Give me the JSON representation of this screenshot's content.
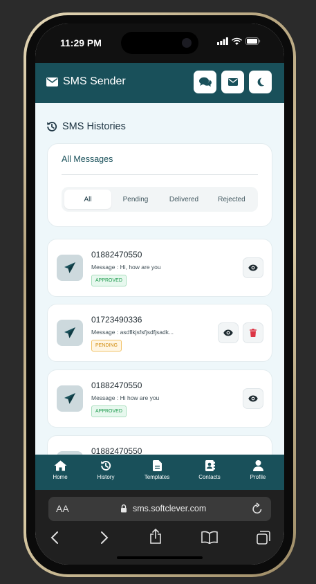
{
  "status_bar": {
    "time": "11:29 PM"
  },
  "header": {
    "title": "SMS Sender",
    "buttons": [
      "chat-icon",
      "envelope-icon",
      "moon-icon"
    ]
  },
  "section": {
    "title": "SMS Histories"
  },
  "filter": {
    "title": "All Messages",
    "tabs": [
      "All",
      "Pending",
      "Delivered",
      "Rejected"
    ],
    "active_tab": "All"
  },
  "messages": [
    {
      "number": "01882470550",
      "text": "Message : Hi, how are you",
      "status": "APPROVED"
    },
    {
      "number": "01723490336",
      "text": "Message : asdflkjsfsfjsdfjsadk...",
      "status": "PENDING"
    },
    {
      "number": "01882470550",
      "text": "Message : Hi how are you",
      "status": "APPROVED"
    },
    {
      "number": "01882470550"
    }
  ],
  "bottom_nav": [
    {
      "label": "Home",
      "icon": "home-icon"
    },
    {
      "label": "History",
      "icon": "history-icon"
    },
    {
      "label": "Templates",
      "icon": "file-icon"
    },
    {
      "label": "Contacts",
      "icon": "contacts-icon"
    },
    {
      "label": "Profile",
      "icon": "user-icon"
    }
  ],
  "browser": {
    "aa": "AA",
    "url": "sms.softclever.com"
  },
  "colors": {
    "primary": "#19505a",
    "background": "#eef7fa",
    "approved": "#1c9a4c",
    "pending": "#d08a0a",
    "delete": "#dc3545"
  }
}
